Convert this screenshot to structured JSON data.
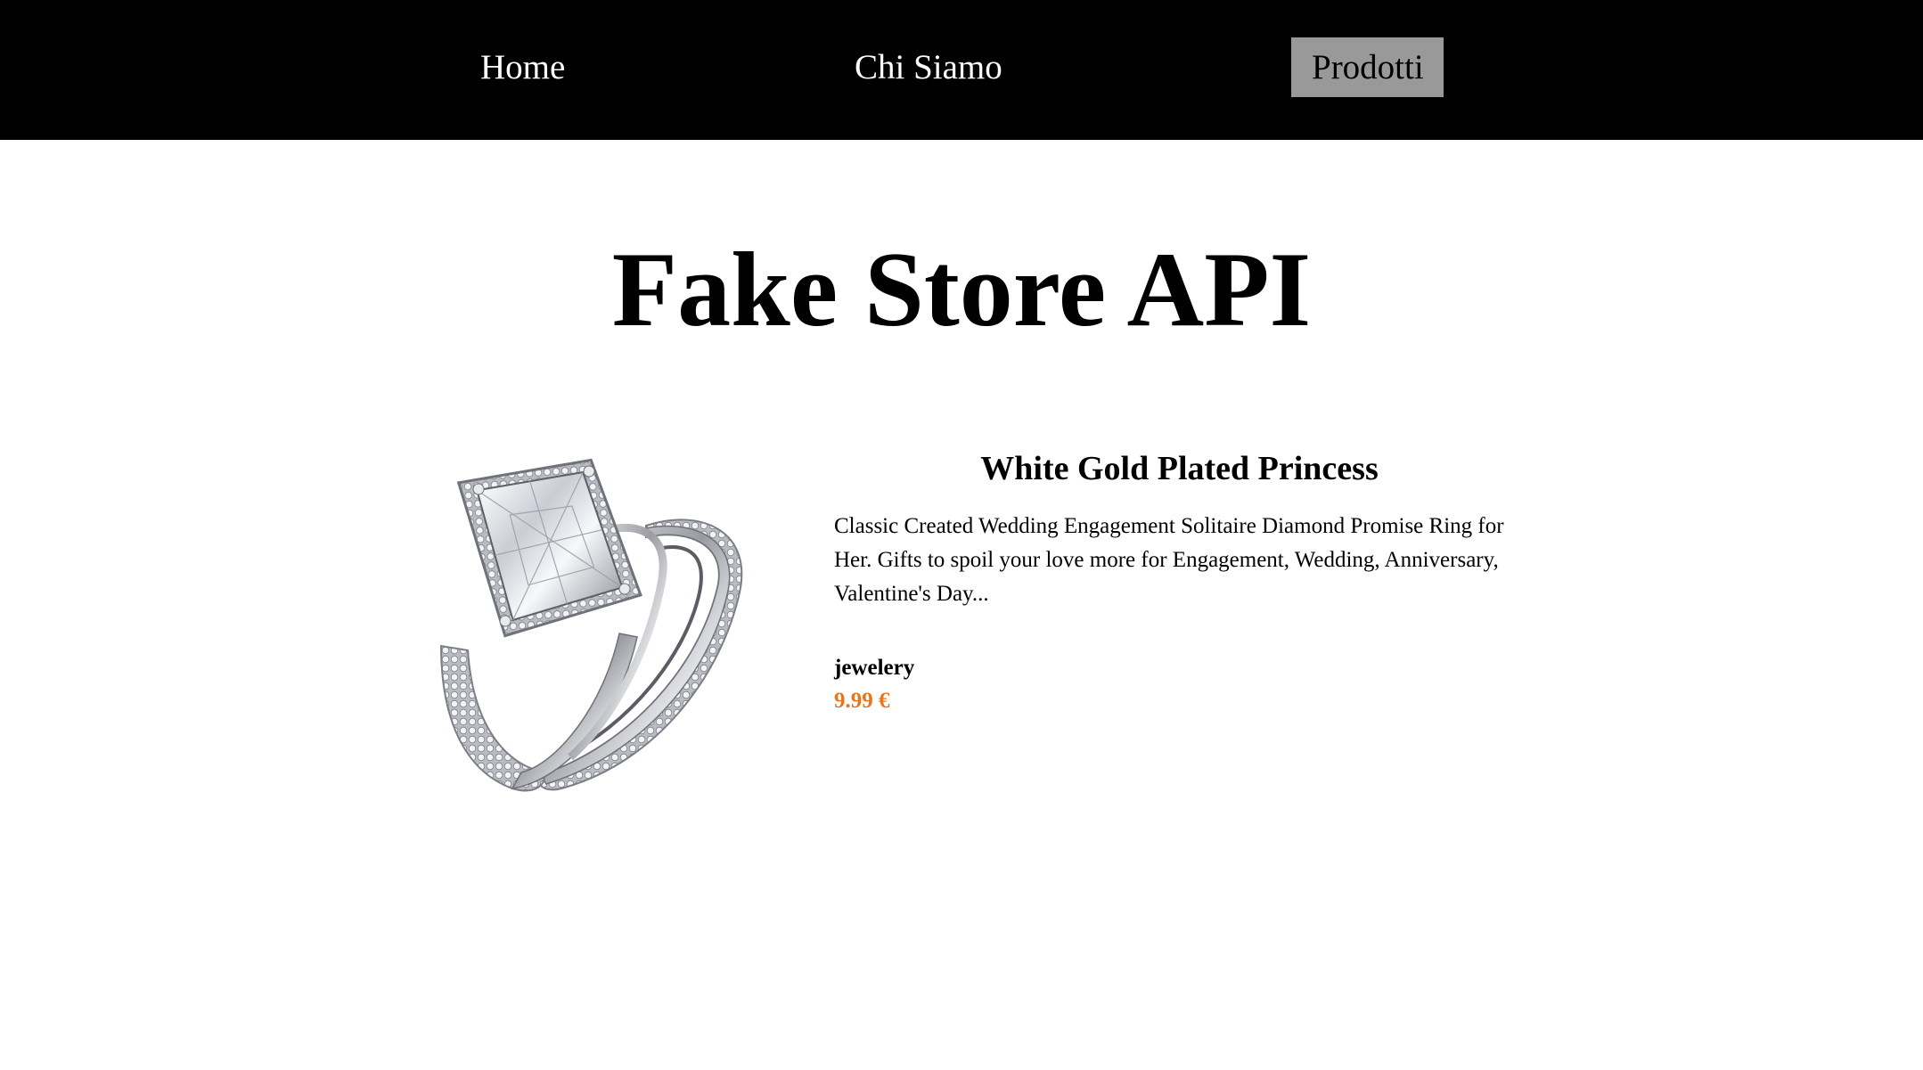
{
  "nav": {
    "items": [
      {
        "label": "Home"
      },
      {
        "label": "Chi Siamo"
      },
      {
        "label": "Prodotti"
      }
    ],
    "active": "Prodotti",
    "active_bg": "#999999",
    "background": "#000000"
  },
  "page": {
    "title": "Fake Store API"
  },
  "product": {
    "image_icon": "diamond-ring-image",
    "title": "White Gold Plated Princess",
    "description": "Classic Created Wedding Engagement Solitaire Diamond Promise Ring for Her. Gifts to spoil your love more for Engagement, Wedding, Anniversary, Valentine's Day...",
    "category": "jewelery",
    "price": "9.99 €",
    "price_color": "#e8741c"
  }
}
